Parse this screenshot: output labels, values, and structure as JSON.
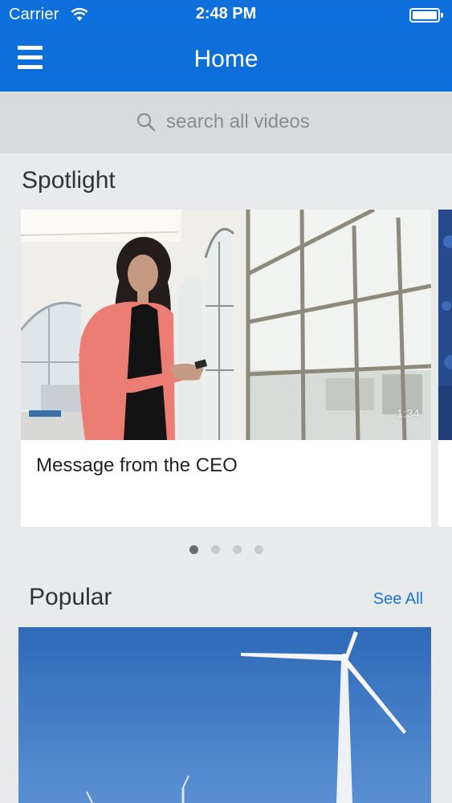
{
  "status_bar": {
    "carrier": "Carrier",
    "time": "2:48 PM"
  },
  "header": {
    "title": "Home",
    "menu_icon": "hamburger-menu-icon"
  },
  "search": {
    "placeholder": "search all videos",
    "icon": "search-icon"
  },
  "spotlight": {
    "title": "Spotlight",
    "items": [
      {
        "caption": "Message from the CEO",
        "duration": "1:34"
      }
    ],
    "pager": {
      "count": 4,
      "active_index": 0
    }
  },
  "popular": {
    "title": "Popular",
    "see_all_label": "See All"
  },
  "colors": {
    "header_blue": "#0f70dc",
    "link_blue": "#1a73d9",
    "background": "#e9eaec",
    "search_band": "#d9dadd"
  }
}
